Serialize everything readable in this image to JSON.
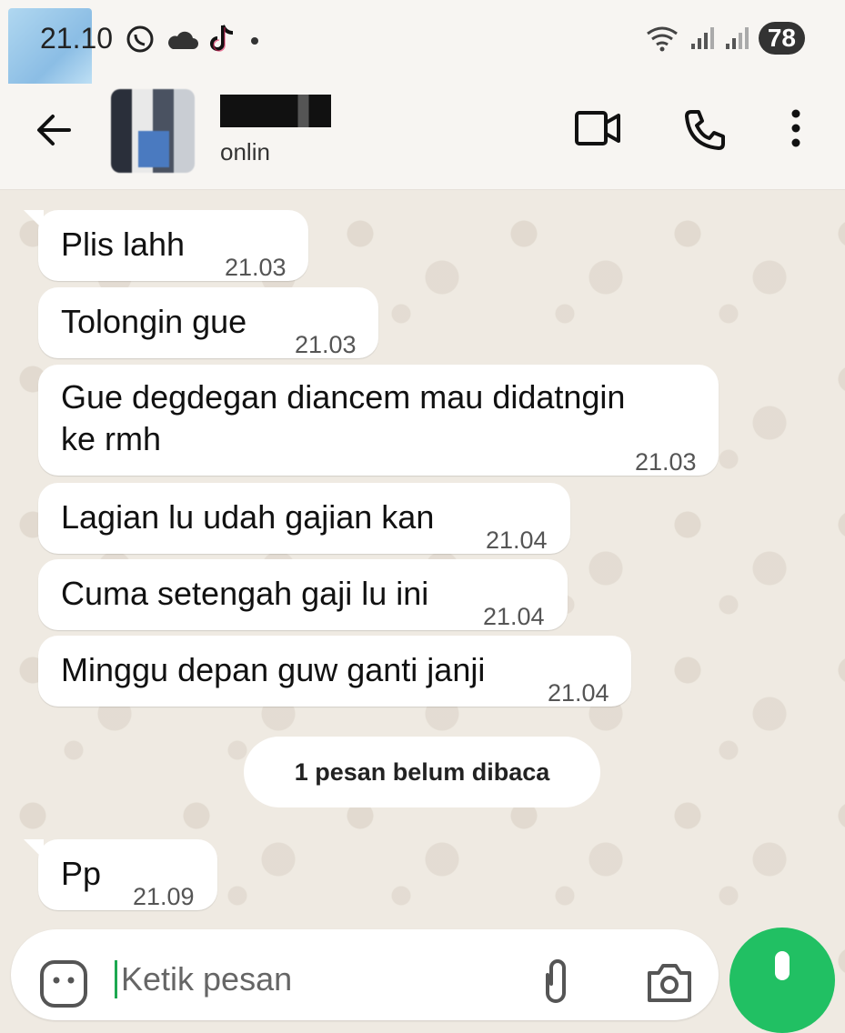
{
  "status_bar": {
    "time": "21.10",
    "battery": "78",
    "icons": [
      "whatsapp-icon",
      "cloud-icon",
      "tiktok-icon",
      "dot-icon",
      "wifi-icon",
      "signal-icon",
      "signal-icon"
    ]
  },
  "header": {
    "status": "onlin",
    "icons": [
      "back-arrow-icon",
      "video-call-icon",
      "phone-call-icon",
      "more-options-icon"
    ]
  },
  "messages": [
    {
      "text": "Plis lahh",
      "time": "21.03"
    },
    {
      "text": "Tolongin gue",
      "time": "21.03"
    },
    {
      "text": "Gue degdegan diancem mau didatngin\nke rmh",
      "time": "21.03"
    },
    {
      "text": "Lagian lu udah gajian kan",
      "time": "21.04"
    },
    {
      "text": "Cuma setengah gaji lu ini",
      "time": "21.04"
    },
    {
      "text": "Minggu depan guw ganti janji",
      "time": "21.04"
    }
  ],
  "unread_label": "1 pesan belum dibaca",
  "new_messages": [
    {
      "text": "Pp",
      "time": "21.09"
    }
  ],
  "input": {
    "placeholder": "Ketik pesan"
  },
  "colors": {
    "accent": "#21c063",
    "chat_bg": "#efeae2",
    "bubble": "#ffffff"
  }
}
